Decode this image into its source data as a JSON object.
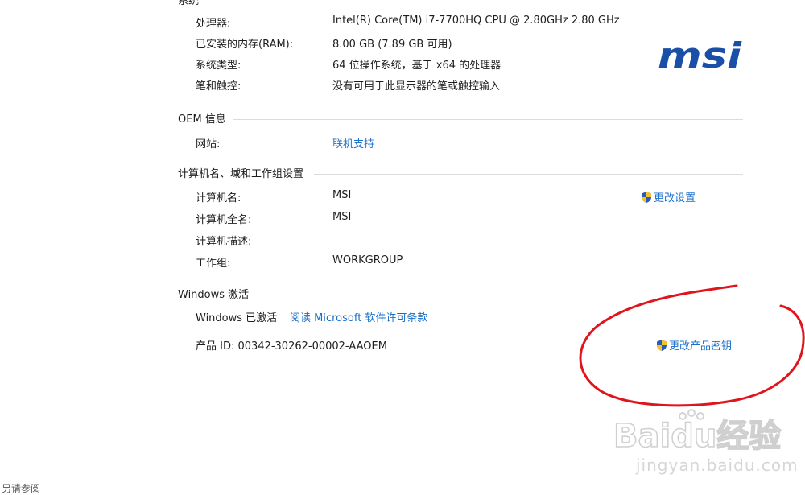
{
  "system": {
    "section_title": "系统",
    "rows": [
      {
        "label": "处理器:",
        "value": "Intel(R) Core(TM) i7-7700HQ CPU @ 2.80GHz   2.80 GHz"
      },
      {
        "label": "已安装的内存(RAM):",
        "value": "8.00 GB (7.89 GB 可用)"
      },
      {
        "label": "系统类型:",
        "value": "64 位操作系统，基于 x64 的处理器"
      },
      {
        "label": "笔和触控:",
        "value": "没有可用于此显示器的笔或触控输入"
      }
    ],
    "logo_text": "msi"
  },
  "oem": {
    "section_title": "OEM 信息",
    "website_label": "网站:",
    "website_link": "联机支持"
  },
  "computer": {
    "section_title": "计算机名、域和工作组设置",
    "change_settings": "更改设置",
    "rows": [
      {
        "label": "计算机名:",
        "value": "MSI"
      },
      {
        "label": "计算机全名:",
        "value": "MSI"
      },
      {
        "label": "计算机描述:",
        "value": ""
      },
      {
        "label": "工作组:",
        "value": "WORKGROUP"
      }
    ]
  },
  "activation": {
    "section_title": "Windows 激活",
    "status": "Windows 已激活",
    "license_link": "阅读 Microsoft 软件许可条款",
    "product_id": "产品 ID: 00342-30262-00002-AAOEM",
    "change_key": "更改产品密钥"
  },
  "footer": {
    "see_also": "另请参阅"
  },
  "watermark": {
    "brand": "Baidu经验",
    "url": "jingyan.baidu.com"
  },
  "colors": {
    "link": "#1a6fc9",
    "annotation": "#e0141c",
    "logo": "#1a4fa8"
  }
}
